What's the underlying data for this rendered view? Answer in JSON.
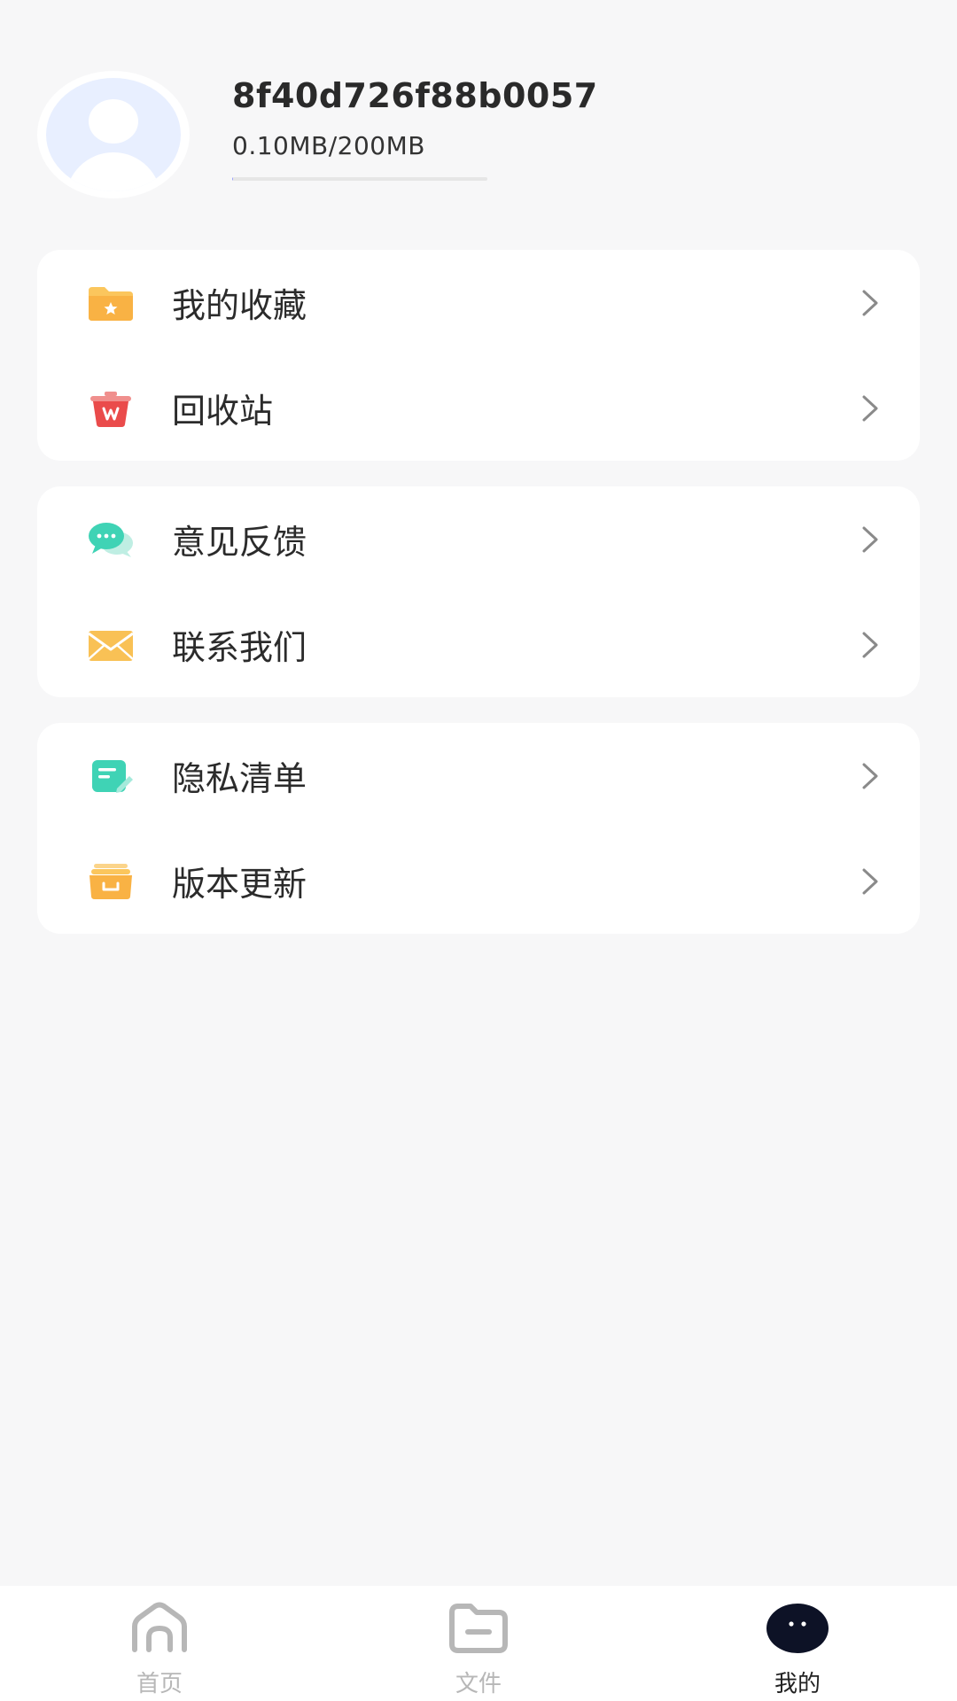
{
  "profile": {
    "user_id": "8f40d726f88b0057",
    "storage_text": "0.10MB/200MB",
    "storage_fraction": 0.0005
  },
  "menu_groups": [
    {
      "items": [
        {
          "label": "我的收藏",
          "icon": "favorites-folder-icon",
          "color": "#f9b94c"
        },
        {
          "label": "回收站",
          "icon": "recycle-bin-icon",
          "color": "#ec5350"
        }
      ]
    },
    {
      "items": [
        {
          "label": "意见反馈",
          "icon": "feedback-chat-icon",
          "color": "#3fd3b5"
        },
        {
          "label": "联系我们",
          "icon": "envelope-icon",
          "color": "#f9c155"
        }
      ]
    },
    {
      "items": [
        {
          "label": "隐私清单",
          "icon": "privacy-list-icon",
          "color": "#3fd3b5"
        },
        {
          "label": "版本更新",
          "icon": "update-box-icon",
          "color": "#f9b94c"
        }
      ]
    }
  ],
  "bottom_nav": {
    "items": [
      {
        "label": "首页",
        "icon": "home-icon",
        "active": false
      },
      {
        "label": "文件",
        "icon": "folder-icon",
        "active": false
      },
      {
        "label": "我的",
        "icon": "profile-face-icon",
        "active": true
      }
    ]
  },
  "colors": {
    "background": "#f7f7f8",
    "card": "#ffffff",
    "active_nav": "#0d1226",
    "inactive_nav": "#b7b7b7"
  }
}
